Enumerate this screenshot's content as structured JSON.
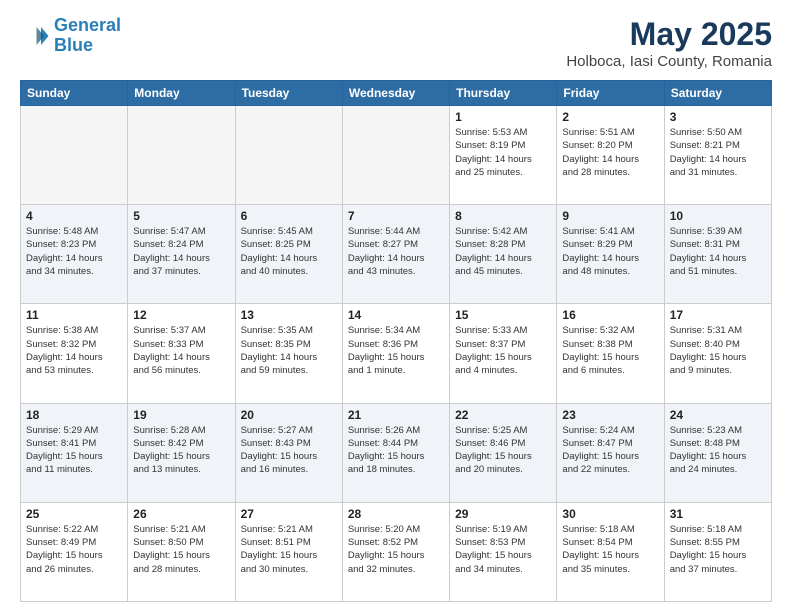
{
  "header": {
    "logo_line1": "General",
    "logo_line2": "Blue",
    "main_title": "May 2025",
    "subtitle": "Holboca, Iasi County, Romania"
  },
  "days_of_week": [
    "Sunday",
    "Monday",
    "Tuesday",
    "Wednesday",
    "Thursday",
    "Friday",
    "Saturday"
  ],
  "weeks": [
    [
      {
        "day": "",
        "info": ""
      },
      {
        "day": "",
        "info": ""
      },
      {
        "day": "",
        "info": ""
      },
      {
        "day": "",
        "info": ""
      },
      {
        "day": "1",
        "info": "Sunrise: 5:53 AM\nSunset: 8:19 PM\nDaylight: 14 hours\nand 25 minutes."
      },
      {
        "day": "2",
        "info": "Sunrise: 5:51 AM\nSunset: 8:20 PM\nDaylight: 14 hours\nand 28 minutes."
      },
      {
        "day": "3",
        "info": "Sunrise: 5:50 AM\nSunset: 8:21 PM\nDaylight: 14 hours\nand 31 minutes."
      }
    ],
    [
      {
        "day": "4",
        "info": "Sunrise: 5:48 AM\nSunset: 8:23 PM\nDaylight: 14 hours\nand 34 minutes."
      },
      {
        "day": "5",
        "info": "Sunrise: 5:47 AM\nSunset: 8:24 PM\nDaylight: 14 hours\nand 37 minutes."
      },
      {
        "day": "6",
        "info": "Sunrise: 5:45 AM\nSunset: 8:25 PM\nDaylight: 14 hours\nand 40 minutes."
      },
      {
        "day": "7",
        "info": "Sunrise: 5:44 AM\nSunset: 8:27 PM\nDaylight: 14 hours\nand 43 minutes."
      },
      {
        "day": "8",
        "info": "Sunrise: 5:42 AM\nSunset: 8:28 PM\nDaylight: 14 hours\nand 45 minutes."
      },
      {
        "day": "9",
        "info": "Sunrise: 5:41 AM\nSunset: 8:29 PM\nDaylight: 14 hours\nand 48 minutes."
      },
      {
        "day": "10",
        "info": "Sunrise: 5:39 AM\nSunset: 8:31 PM\nDaylight: 14 hours\nand 51 minutes."
      }
    ],
    [
      {
        "day": "11",
        "info": "Sunrise: 5:38 AM\nSunset: 8:32 PM\nDaylight: 14 hours\nand 53 minutes."
      },
      {
        "day": "12",
        "info": "Sunrise: 5:37 AM\nSunset: 8:33 PM\nDaylight: 14 hours\nand 56 minutes."
      },
      {
        "day": "13",
        "info": "Sunrise: 5:35 AM\nSunset: 8:35 PM\nDaylight: 14 hours\nand 59 minutes."
      },
      {
        "day": "14",
        "info": "Sunrise: 5:34 AM\nSunset: 8:36 PM\nDaylight: 15 hours\nand 1 minute."
      },
      {
        "day": "15",
        "info": "Sunrise: 5:33 AM\nSunset: 8:37 PM\nDaylight: 15 hours\nand 4 minutes."
      },
      {
        "day": "16",
        "info": "Sunrise: 5:32 AM\nSunset: 8:38 PM\nDaylight: 15 hours\nand 6 minutes."
      },
      {
        "day": "17",
        "info": "Sunrise: 5:31 AM\nSunset: 8:40 PM\nDaylight: 15 hours\nand 9 minutes."
      }
    ],
    [
      {
        "day": "18",
        "info": "Sunrise: 5:29 AM\nSunset: 8:41 PM\nDaylight: 15 hours\nand 11 minutes."
      },
      {
        "day": "19",
        "info": "Sunrise: 5:28 AM\nSunset: 8:42 PM\nDaylight: 15 hours\nand 13 minutes."
      },
      {
        "day": "20",
        "info": "Sunrise: 5:27 AM\nSunset: 8:43 PM\nDaylight: 15 hours\nand 16 minutes."
      },
      {
        "day": "21",
        "info": "Sunrise: 5:26 AM\nSunset: 8:44 PM\nDaylight: 15 hours\nand 18 minutes."
      },
      {
        "day": "22",
        "info": "Sunrise: 5:25 AM\nSunset: 8:46 PM\nDaylight: 15 hours\nand 20 minutes."
      },
      {
        "day": "23",
        "info": "Sunrise: 5:24 AM\nSunset: 8:47 PM\nDaylight: 15 hours\nand 22 minutes."
      },
      {
        "day": "24",
        "info": "Sunrise: 5:23 AM\nSunset: 8:48 PM\nDaylight: 15 hours\nand 24 minutes."
      }
    ],
    [
      {
        "day": "25",
        "info": "Sunrise: 5:22 AM\nSunset: 8:49 PM\nDaylight: 15 hours\nand 26 minutes."
      },
      {
        "day": "26",
        "info": "Sunrise: 5:21 AM\nSunset: 8:50 PM\nDaylight: 15 hours\nand 28 minutes."
      },
      {
        "day": "27",
        "info": "Sunrise: 5:21 AM\nSunset: 8:51 PM\nDaylight: 15 hours\nand 30 minutes."
      },
      {
        "day": "28",
        "info": "Sunrise: 5:20 AM\nSunset: 8:52 PM\nDaylight: 15 hours\nand 32 minutes."
      },
      {
        "day": "29",
        "info": "Sunrise: 5:19 AM\nSunset: 8:53 PM\nDaylight: 15 hours\nand 34 minutes."
      },
      {
        "day": "30",
        "info": "Sunrise: 5:18 AM\nSunset: 8:54 PM\nDaylight: 15 hours\nand 35 minutes."
      },
      {
        "day": "31",
        "info": "Sunrise: 5:18 AM\nSunset: 8:55 PM\nDaylight: 15 hours\nand 37 minutes."
      }
    ]
  ]
}
